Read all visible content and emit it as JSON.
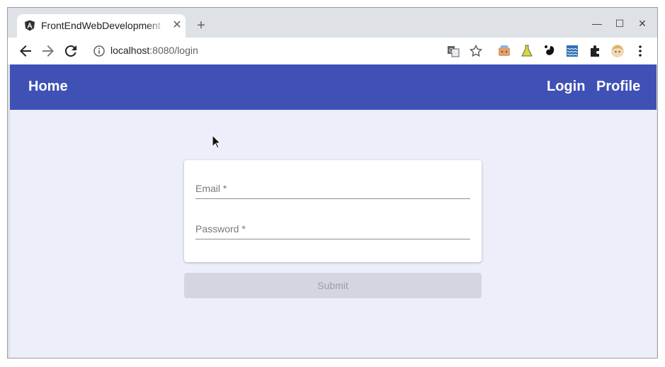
{
  "browser": {
    "tab_title": "FrontEndWebDevelopment",
    "tab_close": "✕",
    "new_tab": "+",
    "window_controls": {
      "minimize": "—",
      "maximize": "☐",
      "close": "✕"
    },
    "url_host": "localhost",
    "url_path": ":8080/login",
    "toolbar_icons": [
      "back-arrow-icon",
      "forward-arrow-icon",
      "reload-icon",
      "site-info-icon",
      "translate-icon",
      "bookmark-star-icon"
    ],
    "extension_icons": [
      "extension-box-icon",
      "extension-flask-icon",
      "extension-gnome-icon",
      "extension-wave-icon",
      "puzzle-icon",
      "profile-avatar-icon",
      "menu-dots-icon"
    ]
  },
  "navbar": {
    "color": "#3f51b5",
    "home": "Home",
    "login": "Login",
    "profile": "Profile"
  },
  "form": {
    "email_label": "Email *",
    "email_value": "",
    "password_label": "Password *",
    "password_value": "",
    "submit_label": "Submit"
  },
  "colors": {
    "page_background": "#eceef9",
    "submit_disabled": "#d4d6df"
  }
}
